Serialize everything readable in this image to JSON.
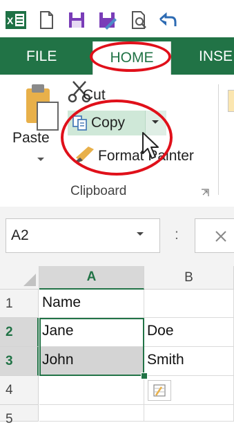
{
  "qat": {
    "icons": [
      "excel-logo-icon",
      "new-document-icon",
      "save-icon",
      "save-as-icon",
      "print-preview-icon",
      "undo-icon"
    ]
  },
  "tabs": {
    "file": "FILE",
    "home": "HOME",
    "insert": "INSE"
  },
  "clipboard": {
    "paste": "Paste",
    "cut": "Cut",
    "copy": "Copy",
    "format_painter": "Format Painter",
    "group_label": "Clipboard"
  },
  "formula_bar": {
    "name_box": "A2",
    "separator": ":"
  },
  "grid": {
    "columns": [
      "A",
      "B"
    ],
    "rows": [
      "1",
      "2",
      "3",
      "4",
      "5"
    ],
    "cells": [
      [
        "Name",
        ""
      ],
      [
        "Jane",
        "Doe"
      ],
      [
        "John",
        "Smith"
      ],
      [
        "",
        ""
      ],
      [
        "",
        ""
      ]
    ]
  },
  "colors": {
    "excel_green": "#217346",
    "annotation_red": "#e0101a",
    "selection_fill": "#cfe8d8"
  }
}
